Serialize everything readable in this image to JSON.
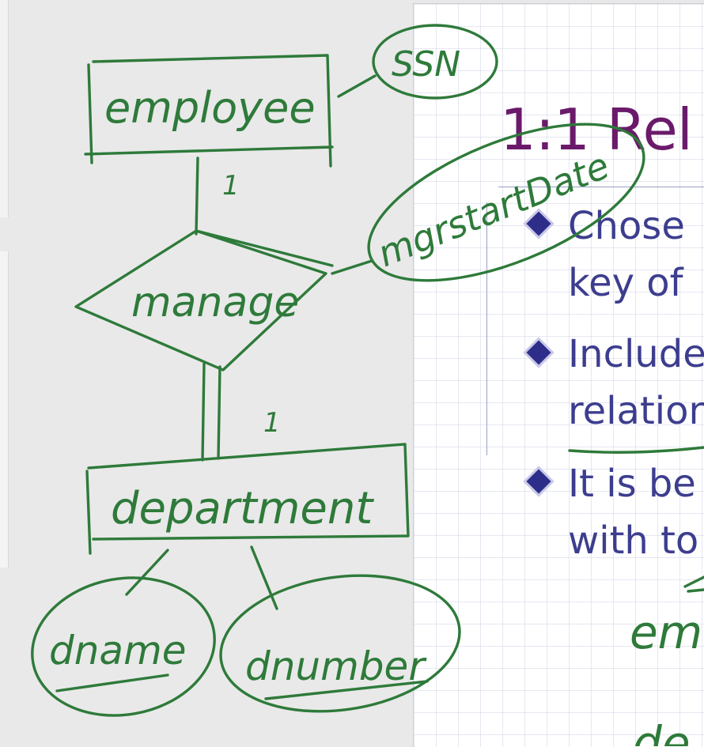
{
  "slide": {
    "title": "1:1 Rel",
    "bullets": [
      {
        "line1": "Chose",
        "line2": "key of"
      },
      {
        "line1": "Include",
        "line2": "relation"
      },
      {
        "line1": "It is be",
        "line2": "with to"
      }
    ]
  },
  "annotations": {
    "entity_employee": "employee",
    "attribute_ssn": "SSN",
    "relationship_manage": "manage",
    "attribute_mgrstartdate": "mgrstartDate",
    "entity_department": "department",
    "attribute_dname": "dname",
    "attribute_dnumber": "dnumber",
    "cardinality_top": "1",
    "cardinality_bottom": "1",
    "slide_ink_1": "em",
    "slide_ink_2": "de"
  },
  "colors": {
    "ink_green": "#2e7a3a",
    "title_purple": "#6b1a6b",
    "bullet_blue": "#3d3d8f"
  }
}
